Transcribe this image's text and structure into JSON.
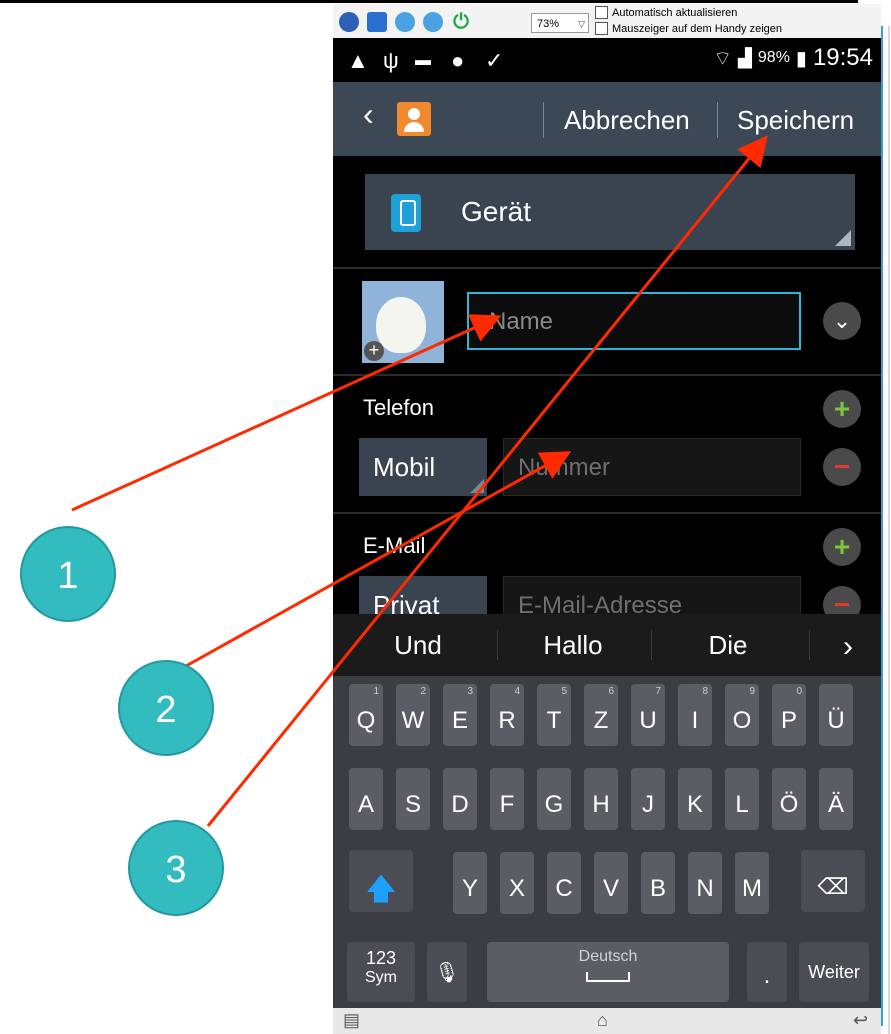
{
  "toolbar": {
    "zoom": "73%",
    "auto_refresh_label": "Automatisch aktualisieren",
    "mouse_pointer_label": "Mauszeiger auf dem Handy zeigen"
  },
  "status_bar": {
    "battery": "98%",
    "time": "19:54"
  },
  "action_bar": {
    "cancel_label": "Abbrechen",
    "save_label": "Speichern"
  },
  "account": {
    "label": "Gerät"
  },
  "name_field": {
    "placeholder": "Name"
  },
  "phone_section": {
    "label": "Telefon",
    "type": "Mobil",
    "placeholder": "Nummer"
  },
  "email_section": {
    "label": "E-Mail",
    "type": "Privat",
    "placeholder": "E-Mail-Adresse"
  },
  "suggestions": [
    "Und",
    "Hallo",
    "Die"
  ],
  "keyboard": {
    "row1": [
      {
        "key": "Q",
        "num": "1"
      },
      {
        "key": "W",
        "num": "2"
      },
      {
        "key": "E",
        "num": "3"
      },
      {
        "key": "R",
        "num": "4"
      },
      {
        "key": "T",
        "num": "5"
      },
      {
        "key": "Z",
        "num": "6"
      },
      {
        "key": "U",
        "num": "7"
      },
      {
        "key": "I",
        "num": "8"
      },
      {
        "key": "O",
        "num": "9"
      },
      {
        "key": "P",
        "num": "0"
      },
      {
        "key": "Ü",
        "num": ""
      }
    ],
    "row2": [
      "A",
      "S",
      "D",
      "F",
      "G",
      "H",
      "J",
      "K",
      "L",
      "Ö",
      "Ä"
    ],
    "row3": [
      "Y",
      "X",
      "C",
      "V",
      "B",
      "N",
      "M"
    ],
    "sym_label": "123",
    "sym_sub": "Sym",
    "space_label": "Deutsch",
    "period": ".",
    "enter_label": "Weiter"
  },
  "annotations": [
    "1",
    "2",
    "3"
  ],
  "colors": {
    "accent": "#2bb8d8",
    "arrow": "#ff2a00",
    "bubble": "#33bcc0",
    "action_bar": "#3d4856"
  }
}
